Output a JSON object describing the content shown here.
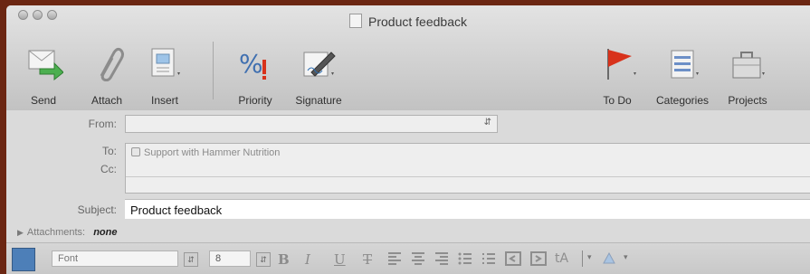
{
  "window": {
    "title": "Product feedback"
  },
  "toolbar": {
    "send": "Send",
    "attach": "Attach",
    "insert": "Insert",
    "priority": "Priority",
    "signature": "Signature",
    "todo": "To Do",
    "categories": "Categories",
    "projects": "Projects"
  },
  "form": {
    "from_label": "From:",
    "to_label": "To:",
    "to_value": "Support with Hammer Nutrition",
    "cc_label": "Cc:",
    "subject_label": "Subject:",
    "subject_value": "Product feedback",
    "attachments_label": "Attachments:",
    "attachments_value": "none"
  },
  "format": {
    "font_value": "Font",
    "size_value": "8",
    "bold": "B",
    "italic": "I",
    "underline": "U",
    "strike": "T"
  },
  "colors": {
    "background": "#6b2612",
    "window": "#d9d9d9",
    "flag": "#d8321b"
  }
}
